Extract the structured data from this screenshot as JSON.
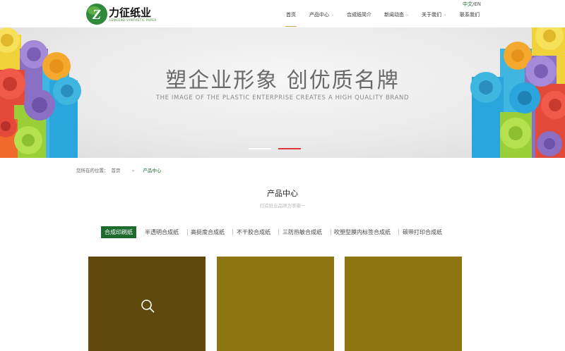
{
  "brand": {
    "name": "力征纸业",
    "subtitle": "LENGEND SYNTHETIC PAPER",
    "logo_letter": "Z",
    "logo_color": "#2f8a3a"
  },
  "language": {
    "cn": "中文",
    "sep": "/",
    "en": "EN"
  },
  "nav": {
    "items": [
      {
        "label": "首页",
        "active": true,
        "has_caret": false
      },
      {
        "label": "产品中心",
        "has_caret": true
      },
      {
        "label": "合成纸简介",
        "has_caret": false
      },
      {
        "label": "新闻动态",
        "has_caret": true
      },
      {
        "label": "关于我们",
        "has_caret": true
      },
      {
        "label": "联系我们",
        "has_caret": false
      }
    ],
    "caret_icon": "chevron-down-icon",
    "active_underline_color": "#d6a75a"
  },
  "banner": {
    "title": "塑企业形象  创优质名牌",
    "subtitle": "THE IMAGE OF THE PLASTIC ENTERPRISE CREATES A HIGH QUALITY BRAND",
    "active_dot_color": "#d9363e"
  },
  "breadcrumb": {
    "prefix": "您所在的位置：",
    "home": "首页",
    "separator": "»",
    "current": "产品中心"
  },
  "section": {
    "title": "产品中心",
    "subtitle": "打造纸业品牌为李豪一"
  },
  "tabs": [
    {
      "label": "合成印刷纸",
      "active": true
    },
    {
      "label": "半透明合成纸"
    },
    {
      "label": "高挺度合成纸"
    },
    {
      "label": "不干胶合成纸"
    },
    {
      "label": "三防热敏合成纸"
    },
    {
      "label": "吹塑型膜内标签合成纸"
    },
    {
      "label": "碳带打印合成纸"
    }
  ],
  "accent_color": "#1e6b2e",
  "products": [
    {
      "color": "#6b5511",
      "hover": true,
      "icon": "search-icon"
    },
    {
      "color": "#8f7512"
    },
    {
      "color": "#8f7512"
    }
  ]
}
